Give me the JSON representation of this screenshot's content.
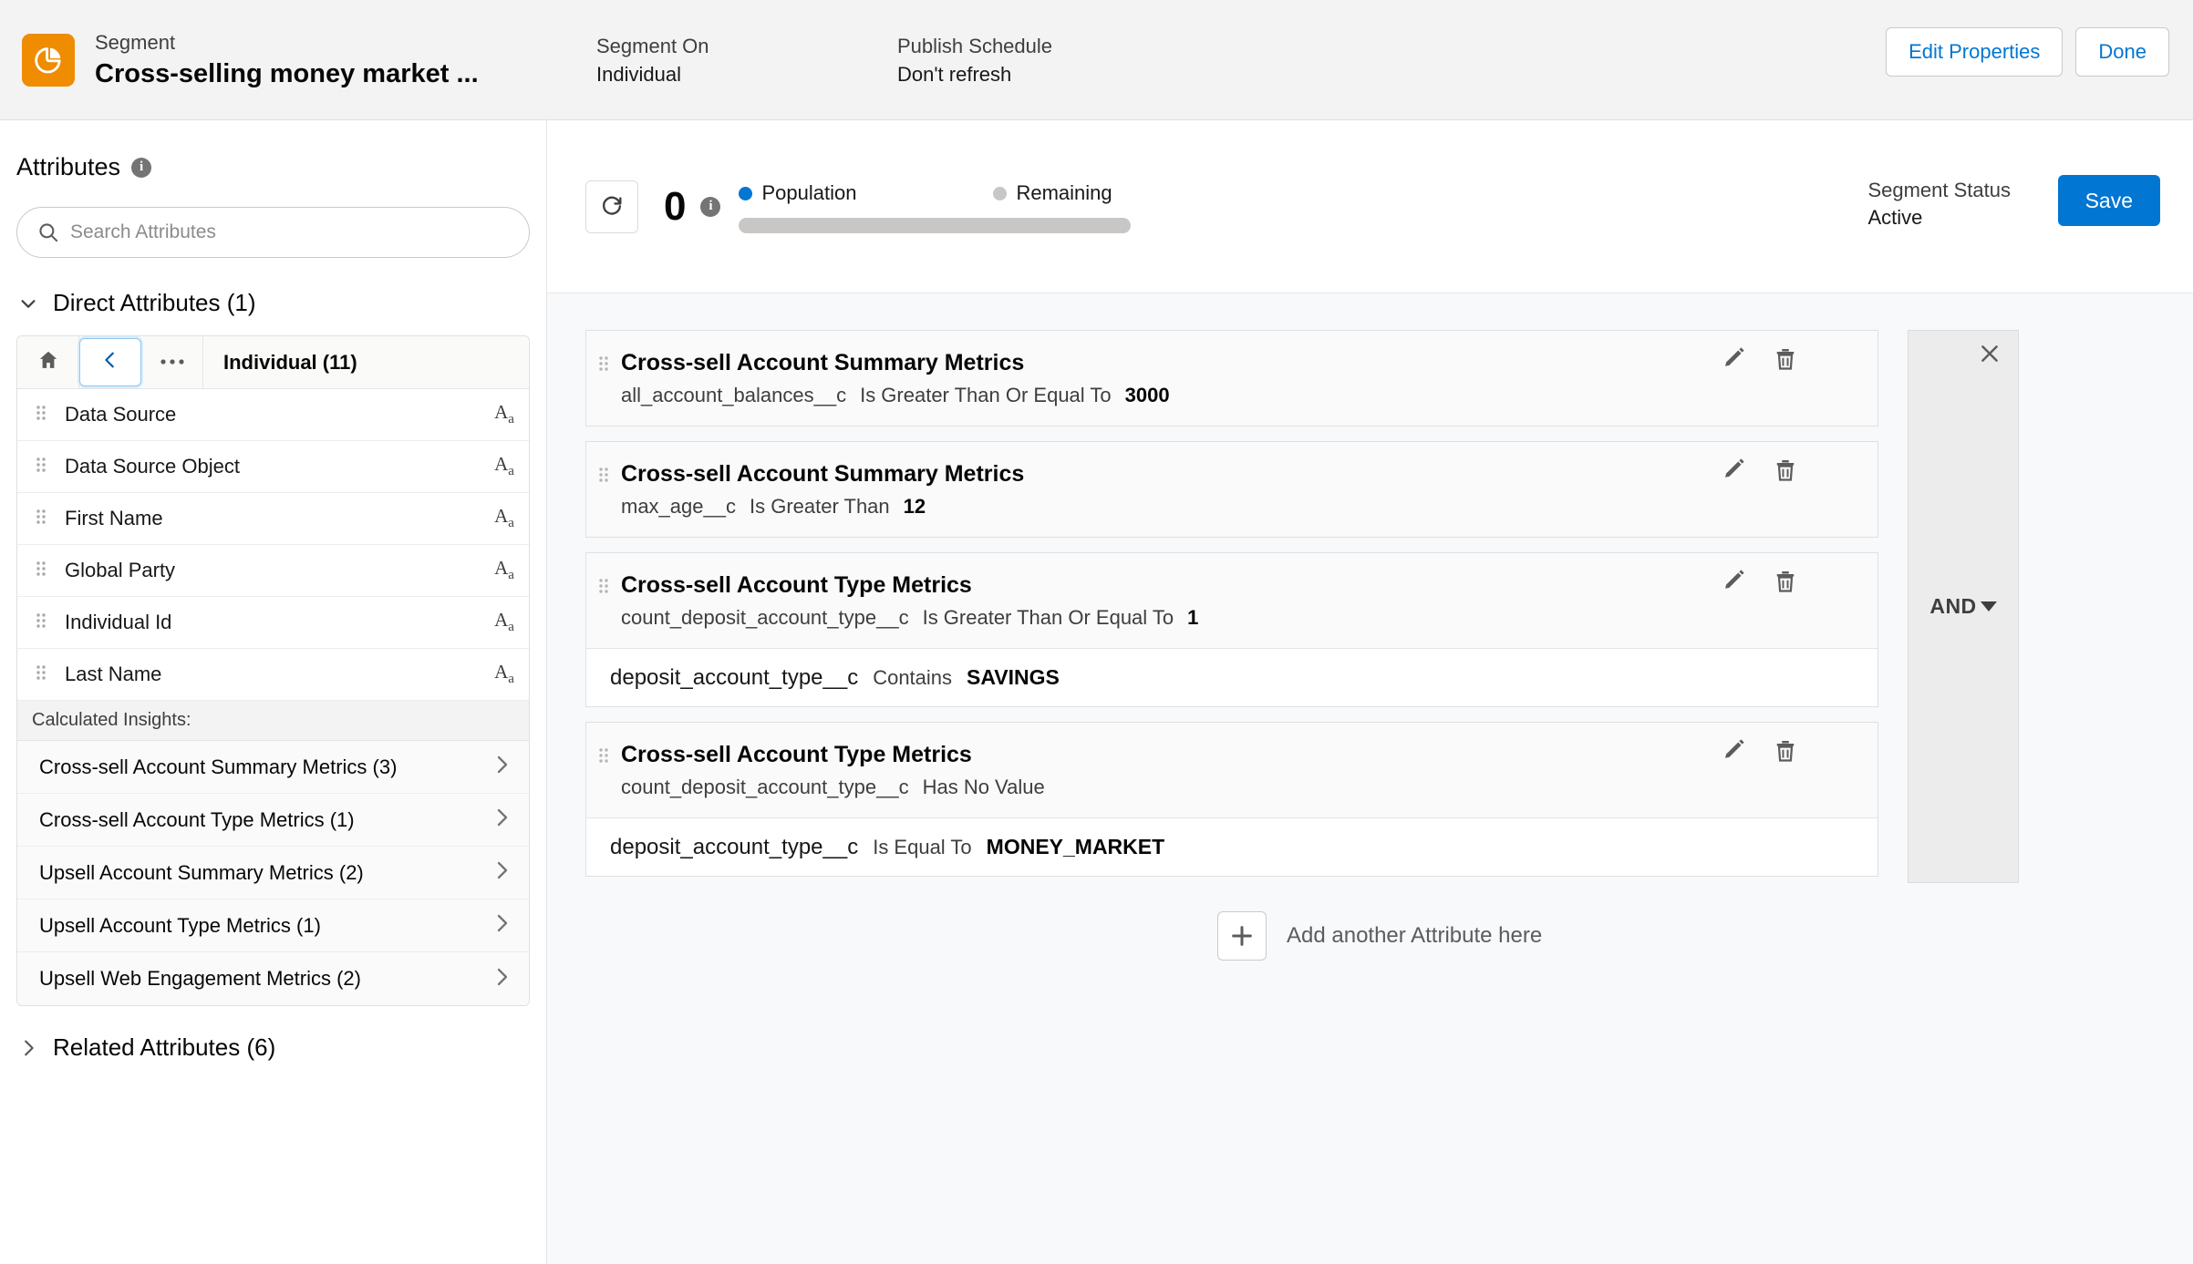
{
  "header": {
    "brand_icon": "segment-pie-icon",
    "eyebrow": "Segment",
    "title": "Cross-selling money market ...",
    "segment_on_label": "Segment On",
    "segment_on_value": "Individual",
    "publish_schedule_label": "Publish Schedule",
    "publish_schedule_value": "Don't refresh",
    "edit_properties_label": "Edit Properties",
    "done_label": "Done"
  },
  "sidebar": {
    "title": "Attributes",
    "info_glyph": "i",
    "search_placeholder": "Search Attributes",
    "search_value": "",
    "direct_section_label": "Direct Attributes (1)",
    "breadcrumb": {
      "home_icon": "home-icon",
      "back_icon": "chevron-left-icon",
      "more_icon": "ellipsis-icon",
      "current": "Individual (11)"
    },
    "attributes": [
      {
        "name": "Data Source",
        "type": "Aa"
      },
      {
        "name": "Data Source Object",
        "type": "Aa"
      },
      {
        "name": "First Name",
        "type": "Aa"
      },
      {
        "name": "Global Party",
        "type": "Aa"
      },
      {
        "name": "Individual Id",
        "type": "Aa"
      },
      {
        "name": "Last Name",
        "type": "Aa"
      }
    ],
    "calculated_insights_header": "Calculated Insights:",
    "calculated_insights": [
      {
        "name": "Cross-sell Account Summary Metrics",
        "count": "(3)"
      },
      {
        "name": "Cross-sell Account Type Metrics",
        "count": "(1)"
      },
      {
        "name": "Upsell Account Summary Metrics",
        "count": "(2)"
      },
      {
        "name": "Upsell Account Type Metrics",
        "count": "(1)"
      },
      {
        "name": "Upsell Web Engagement Metrics",
        "count": "(2)"
      }
    ],
    "related_section_label": "Related Attributes (6)"
  },
  "canvas": {
    "refresh_icon": "refresh-icon",
    "population_count": "0",
    "population_info_glyph": "i",
    "legend_population": "Population",
    "legend_remaining": "Remaining",
    "population_color": "#0176d3",
    "remaining_color": "#c9c7c5",
    "progress_percent": 0,
    "segment_status_label": "Segment Status",
    "segment_status_value": "Active",
    "save_label": "Save",
    "and_operator": "AND",
    "and_close_icon": "close-icon",
    "add_attribute_label": "Add another Attribute here",
    "add_icon": "plus-icon",
    "edit_icon": "pencil-icon",
    "delete_icon": "trash-icon",
    "rules": [
      {
        "title": "Cross-sell Account Summary Metrics",
        "field": "all_account_balances__c",
        "operator": "Is Greater Than Or Equal To",
        "value": "3000",
        "sub": null
      },
      {
        "title": "Cross-sell Account Summary Metrics",
        "field": "max_age__c",
        "operator": "Is Greater Than",
        "value": "12",
        "sub": null
      },
      {
        "title": "Cross-sell Account Type Metrics",
        "field": "count_deposit_account_type__c",
        "operator": "Is Greater Than Or Equal To",
        "value": "1",
        "sub": {
          "field": "deposit_account_type__c",
          "operator": "Contains",
          "value": "SAVINGS"
        }
      },
      {
        "title": "Cross-sell Account Type Metrics",
        "field": "count_deposit_account_type__c",
        "operator": "Has No Value",
        "value": "",
        "sub": {
          "field": "deposit_account_type__c",
          "operator": "Is Equal To",
          "value": "MONEY_MARKET"
        }
      }
    ]
  }
}
